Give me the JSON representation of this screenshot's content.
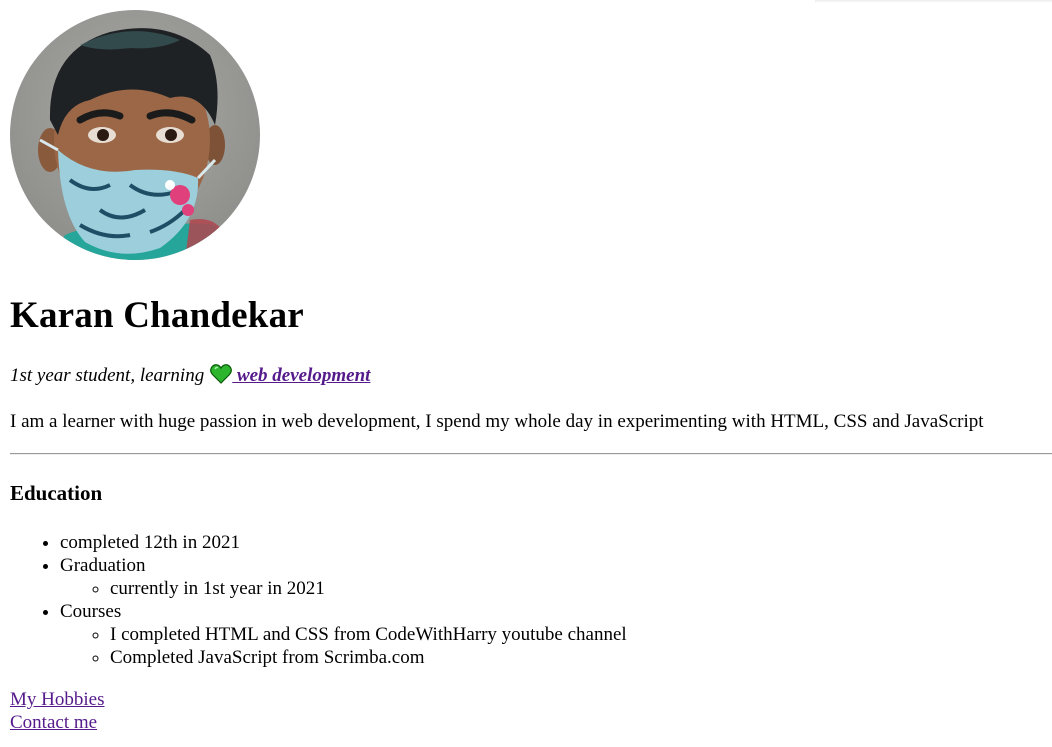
{
  "profile": {
    "name": "Karan Chandekar",
    "tagline_prefix": "1st year student, learning",
    "tagline_link": " web development",
    "bio": "I am a learner with huge passion in web development, I spend my whole day in experimenting with HTML, CSS and JavaScript"
  },
  "education": {
    "heading": "Education",
    "items": [
      {
        "label": "completed 12th in 2021"
      },
      {
        "label": "Graduation",
        "sub": [
          "currently in 1st year in 2021"
        ]
      },
      {
        "label": "Courses",
        "sub": [
          "I completed HTML and CSS from CodeWithHarry youtube channel",
          "Completed JavaScript from Scrimba.com"
        ]
      }
    ]
  },
  "links": {
    "hobbies": "My Hobbies",
    "contact": "Contact me"
  },
  "colors": {
    "link_visited": "#551a8b",
    "heart": "#2db52d",
    "divider": "#9a9a9a"
  },
  "icons": {
    "heart": "green-heart-icon",
    "avatar": "profile-photo"
  }
}
